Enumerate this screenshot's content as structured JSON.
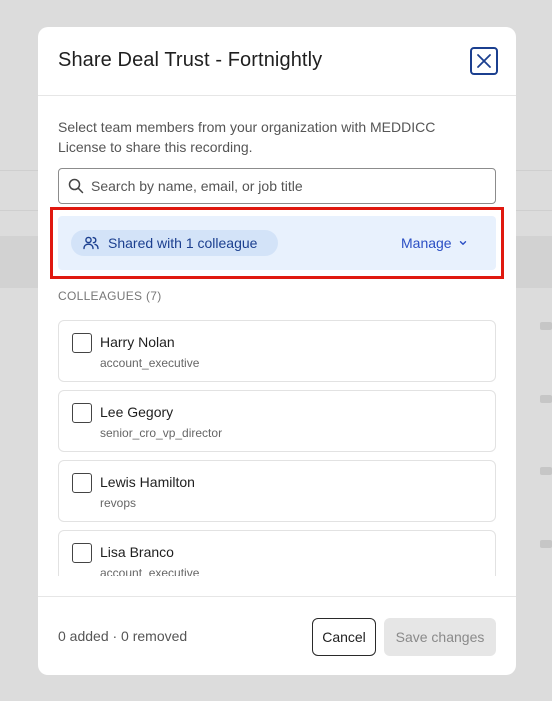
{
  "modal": {
    "title": "Share Deal Trust - Fortnightly",
    "description": "Select team members from your organization with MEDDICC License to share this recording.",
    "close_icon": "close-icon"
  },
  "search": {
    "placeholder": "Search by name, email, or job title",
    "value": "",
    "icon": "search-icon"
  },
  "shared": {
    "label": "Shared with 1 colleague",
    "icon": "users-icon",
    "manage_label": "Manage",
    "manage_icon": "chevron-down-icon"
  },
  "colleagues": {
    "section_label": "COLLEAGUES (7)",
    "items": [
      {
        "name": "Harry Nolan",
        "role": "account_executive",
        "checked": false
      },
      {
        "name": "Lee Gegory",
        "role": "senior_cro_vp_director",
        "checked": false
      },
      {
        "name": "Lewis Hamilton",
        "role": "revops",
        "checked": false
      },
      {
        "name": "Lisa Branco",
        "role": "account_executive",
        "checked": false
      }
    ]
  },
  "footer": {
    "counts": "0 added · 0 removed",
    "cancel_label": "Cancel",
    "save_label": "Save changes"
  },
  "colors": {
    "accent": "#2b4fc4",
    "highlight_border": "#e0180f",
    "shared_bg": "#e8f1fd"
  }
}
